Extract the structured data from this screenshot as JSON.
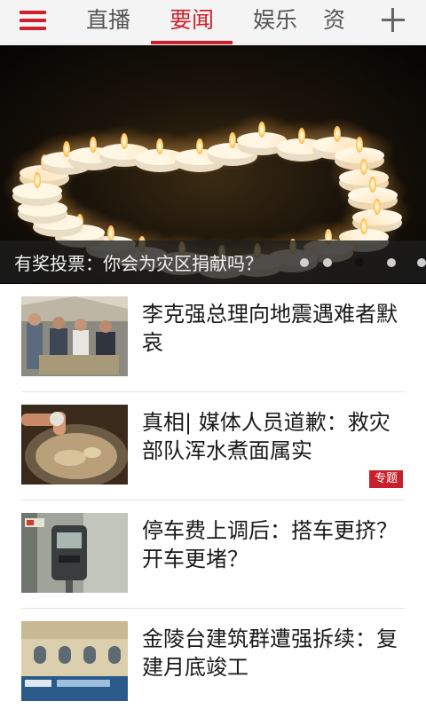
{
  "tabs": [
    "直播",
    "要闻",
    "娱乐",
    "资"
  ],
  "active_tab": 1,
  "hero": {
    "caption": "有奖投票：你会为灾区捐献吗？",
    "slide_count": 5,
    "active_slide": 1
  },
  "news": [
    {
      "title": "李克强总理向地震遇难者默哀",
      "badge": ""
    },
    {
      "title": "真相| 媒体人员道歉：救灾部队浑水煮面属实",
      "badge": "专题"
    },
    {
      "title": "停车费上调后：搭车更挤？开车更堵？",
      "badge": ""
    },
    {
      "title": "金陵台建筑群遭强拆续：复建月底竣工",
      "badge": ""
    }
  ],
  "colors": {
    "accent": "#d0202a",
    "badge": "#c8202a"
  },
  "icons": {
    "menu": "hamburger-menu-icon",
    "add": "plus-icon"
  }
}
